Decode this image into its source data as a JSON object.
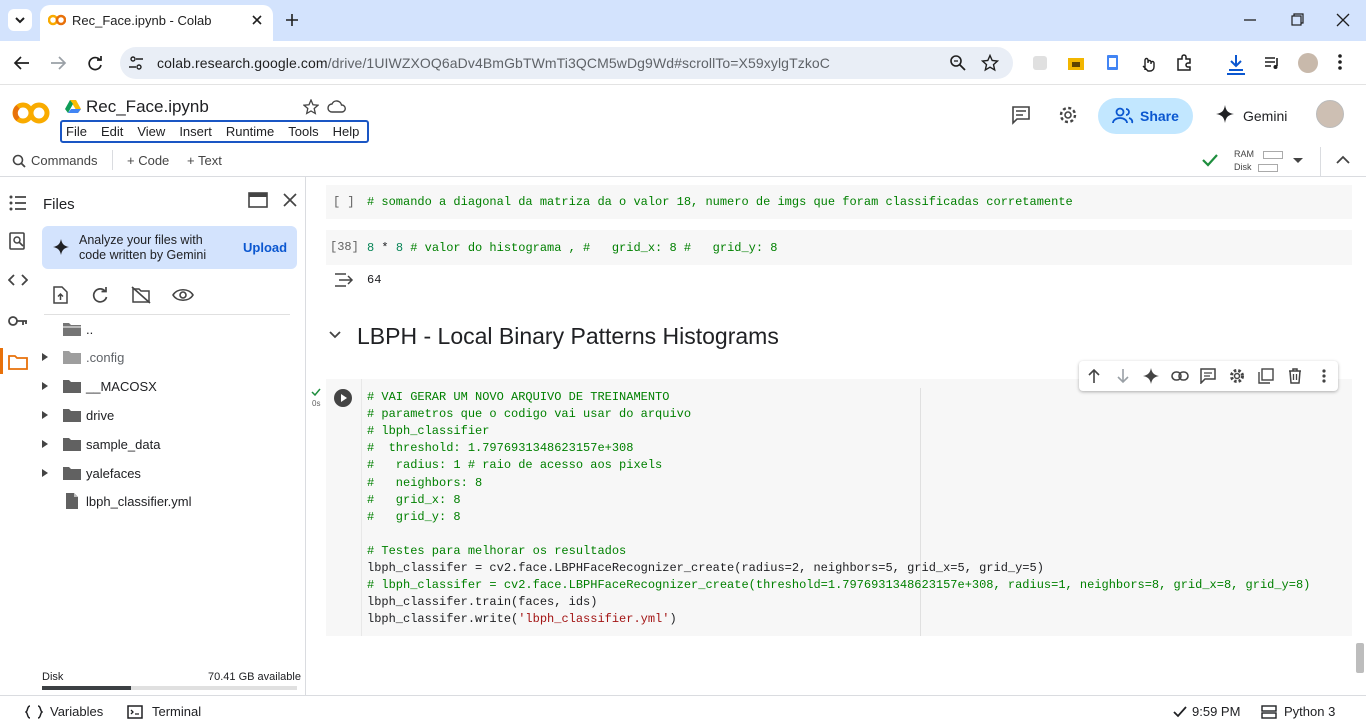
{
  "browser": {
    "tab_title": "Rec_Face.ipynb - Colab",
    "url_host": "colab.research.google.com",
    "url_path": "/drive/1UIWZXOQ6aDv4BmGbTWmTi3QCM5wDg9Wd#scrollTo=X59xylgTzkoC"
  },
  "header": {
    "title": "Rec_Face.ipynb",
    "menu": [
      "File",
      "Edit",
      "View",
      "Insert",
      "Runtime",
      "Tools",
      "Help"
    ],
    "share_label": "Share",
    "gemini_label": "Gemini"
  },
  "commands": {
    "commands_label": "Commands",
    "code_label": "+ Code",
    "text_label": "+ Text",
    "ram_label": "RAM",
    "disk_label": "Disk"
  },
  "sidebar": {
    "title": "Files",
    "gemini_prompt_line1": "Analyze your files with",
    "gemini_prompt_line2": "code written by Gemini",
    "upload_label": "Upload",
    "tree": [
      {
        "name": "..",
        "type": "parent"
      },
      {
        "name": ".config",
        "type": "folder"
      },
      {
        "name": "__MACOSX",
        "type": "folder"
      },
      {
        "name": "drive",
        "type": "folder"
      },
      {
        "name": "sample_data",
        "type": "folder"
      },
      {
        "name": "yalefaces",
        "type": "folder"
      },
      {
        "name": "lbph_classifier.yml",
        "type": "file"
      }
    ],
    "disk_label": "Disk",
    "disk_available": "70.41 GB available",
    "disk_used_fraction": 0.35
  },
  "notebook": {
    "cell1": {
      "exec": "[ ]",
      "code": "# somando a diagonal da matriza da o valor 18, numero de imgs que foram classificadas corretamente"
    },
    "cell2": {
      "exec": "[38]",
      "code": "8 * 8 # valor do histograma , #   grid_x: 8 #   grid_y: 8",
      "output": "64"
    },
    "section_heading": "LBPH - Local Binary Patterns Histograms",
    "cell3": {
      "exec_time": "0s",
      "lines": [
        "# VAI GERAR UM NOVO ARQUIVO DE TREINAMENTO",
        "# parametros que o codigo vai usar do arquivo",
        "# lbph_classifier",
        "#  threshold: 1.7976931348623157e+308",
        "#   radius: 1 # raio de acesso aos pixels",
        "#   neighbors: 8",
        "#   grid_x: 8",
        "#   grid_y: 8",
        "",
        "# Testes para melhorar os resultados",
        "lbph_classifer = cv2.face.LBPHFaceRecognizer_create(radius=2, neighbors=5, grid_x=5, grid_y=5)",
        "# lbph_classifer = cv2.face.LBPHFaceRecognizer_create(threshold=1.7976931348623157e+308, radius=1, neighbors=8, grid_x=8, grid_y=8)",
        "lbph_classifer.train(faces, ids)",
        "lbph_classifer.write('lbph_classifier.yml')"
      ]
    }
  },
  "statusbar": {
    "variables_label": "Variables",
    "terminal_label": "Terminal",
    "time": "9:59 PM",
    "runtime": "Python 3"
  },
  "colors": {
    "accent": "#0b57d0",
    "share_bg": "#c2e7ff",
    "tabstrip_bg": "#d3e3fd",
    "comment": "#008000",
    "string": "#a31515",
    "colab_orange": "#f9ab00"
  }
}
